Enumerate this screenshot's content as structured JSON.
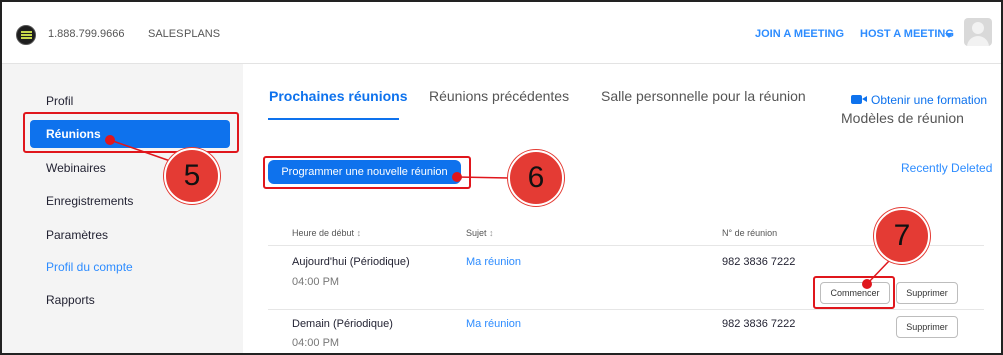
{
  "topbar": {
    "phone": "1.888.799.9666",
    "sales": "SALES",
    "plans": "PLANS",
    "join": "JOIN A MEETING",
    "host": "HOST A MEETING"
  },
  "sidebar": {
    "items": [
      {
        "label": "Profil"
      },
      {
        "label": "Réunions"
      },
      {
        "label": "Webinaires"
      },
      {
        "label": "Enregistrements"
      },
      {
        "label": "Paramètres"
      },
      {
        "label": "Profil du compte"
      },
      {
        "label": "Rapports"
      }
    ]
  },
  "tabs": [
    {
      "label": "Prochaines réunions"
    },
    {
      "label": "Réunions précédentes"
    },
    {
      "label": "Salle personnelle pour la réunion"
    }
  ],
  "training_link": "Obtenir une formation",
  "templates": "Modèles de réunion",
  "recently_deleted": "Recently Deleted",
  "schedule_button": "Programmer une nouvelle réunion",
  "table": {
    "headers": [
      "Heure de début",
      "Sujet",
      "N° de réunion"
    ],
    "sort_glyph": "↕",
    "rows": [
      {
        "date": "Aujourd'hui (Périodique)",
        "time": "04:00 PM",
        "topic": "Ma réunion",
        "id": "982 3836 7222",
        "start": "Commencer",
        "delete": "Supprimer"
      },
      {
        "date": "Demain (Périodique)",
        "time": "04:00 PM",
        "topic": "Ma réunion",
        "id": "982 3836 7222",
        "delete": "Supprimer"
      }
    ]
  },
  "annotations": [
    "5",
    "6",
    "7"
  ],
  "colors": {
    "accent": "#0e72ed",
    "link": "#2d8cff",
    "annotation": "#e0161c",
    "sidebar_bg": "#f4f4f4"
  }
}
